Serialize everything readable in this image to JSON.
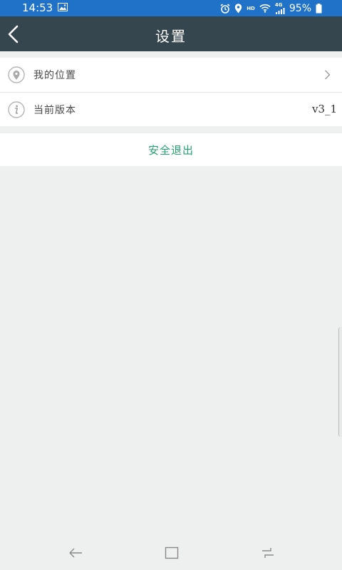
{
  "status_bar": {
    "time": "14:53",
    "network": "4G",
    "network_label": "HD",
    "battery": "95%"
  },
  "header": {
    "title": "设置"
  },
  "settings": {
    "location": {
      "label": "我的位置"
    },
    "version": {
      "label": "当前版本",
      "value": "v3_1"
    }
  },
  "logout": {
    "label": "安全退出"
  },
  "colors": {
    "status_bar": "#1f72c7",
    "title_bar": "#36464f",
    "accent": "#23a26f",
    "background": "#eeefef"
  },
  "icons": {
    "back": "chevron-left-icon",
    "location": "location-pin-icon",
    "info": "info-icon",
    "chevron": "chevron-right-icon"
  }
}
